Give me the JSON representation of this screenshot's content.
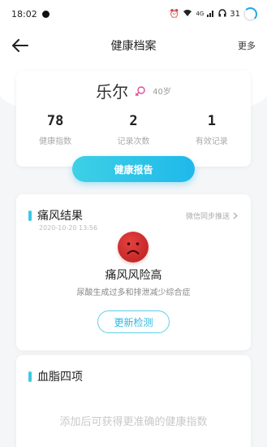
{
  "status_bar": {
    "time": "18:02",
    "network": "4G",
    "battery": "31"
  },
  "header": {
    "title": "健康档案",
    "more_label": "更多",
    "back_icon": "arrow-left-icon"
  },
  "profile": {
    "name": "乐尔",
    "gender_icon": "female-icon",
    "age": "40岁",
    "stats": [
      {
        "value": "78",
        "label": "健康指数"
      },
      {
        "value": "2",
        "label": "记录次数"
      },
      {
        "value": "1",
        "label": "有效记录"
      }
    ],
    "report_button": "健康报告"
  },
  "gout": {
    "title": "痛风结果",
    "date": "2020-10-20 13:56",
    "sync_label": "微信同步推送",
    "result_title": "痛风风险高",
    "result_desc": "尿酸生成过多和排泄减少综合症",
    "recheck_button": "更新检测",
    "result_icon": "sad-face-icon"
  },
  "lipid": {
    "title": "血脂四项",
    "hint": "添加后可获得更准确的健康指数"
  },
  "colors": {
    "accent": "#1fb9ea",
    "accent_light": "#3ed0e6",
    "danger": "#d02a29",
    "background": "#f4f6f8"
  }
}
